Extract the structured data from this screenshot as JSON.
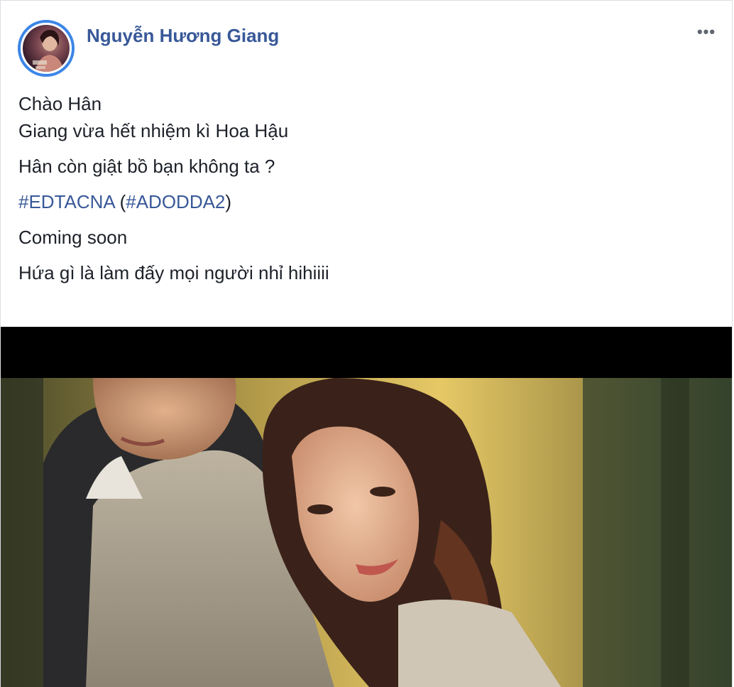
{
  "post": {
    "author_name": "Nguyễn Hương Giang",
    "more_icon_text": "•••",
    "lines": {
      "line1": "Chào Hân",
      "line2": "Giang vừa hết nhiệm kì Hoa Hậu",
      "line3": "Hân còn giật bồ bạn không ta ?",
      "hashtag1": "#EDTACNA",
      "paren_open": " (",
      "hashtag2": "#ADODDA2",
      "paren_close": ")",
      "line5": "Coming soon",
      "line6": "Hứa gì là làm đấy mọi người nhỉ hihiiii"
    }
  },
  "colors": {
    "author": "#385898",
    "hashtag": "#385898",
    "text": "#1d2129",
    "avatar_ring": "#3b86e7"
  },
  "icons": {
    "more": "more-options-icon"
  }
}
